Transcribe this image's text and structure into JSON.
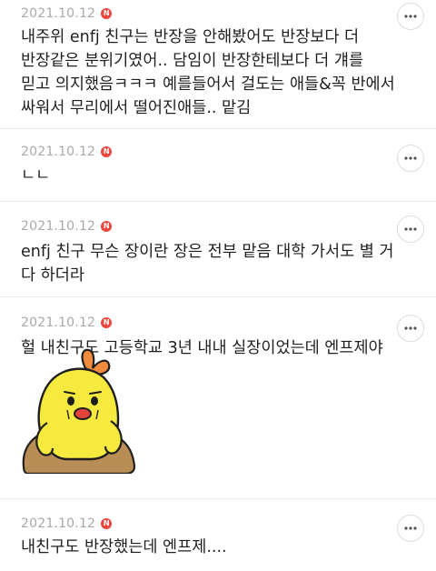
{
  "comments": [
    {
      "date": "2021.10.12",
      "badge": "N",
      "text": "내주위 enfj 친구는 반장을 안해봤어도 반장보다 더 반장같은 분위기였어.. 담임이 반장한테보다 더 걔를 믿고 의지했음ㅋㅋㅋ 예를들어서 걸도는 애들&꼭 반에서 싸워서 무리에서 떨어진애들.. 맡김"
    },
    {
      "date": "2021.10.12",
      "badge": "N",
      "text": "ㄴㄴ"
    },
    {
      "date": "2021.10.12",
      "badge": "N",
      "text": "enfj 친구 무슨 장이란 장은 전부 맡음 대학 가서도 별 거 다 하더라"
    },
    {
      "date": "2021.10.12",
      "badge": "N",
      "text": "헐 내친구도 고등학교 3년 내내 실장이었는데 엔프제야",
      "sticker": "yellow-chick-sticker"
    },
    {
      "date": "2021.10.12",
      "badge": "N",
      "text": "내친구도 반장했는데 엔프제...."
    }
  ],
  "icons": {
    "more": "more-options-icon",
    "badge": "new-badge-icon"
  },
  "colors": {
    "badge": "#f0473f",
    "date": "#a9a9a9",
    "divider": "#e9e9e9",
    "sticker_body": "#f7ea3f",
    "sticker_rock": "#b98d56"
  }
}
